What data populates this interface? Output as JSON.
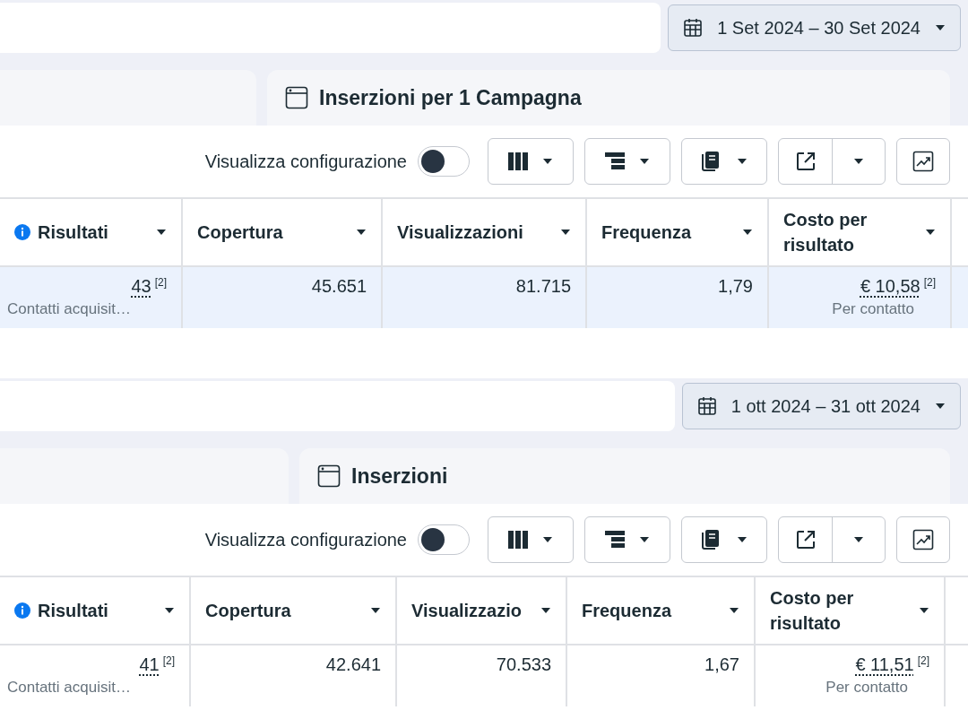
{
  "panels": [
    {
      "date_range": "1 Set 2024 – 30 Set 2024",
      "tab_title": "Inserzioni per 1 Campagna",
      "toggle_label": "Visualizza configurazione",
      "toggle_on": false,
      "columns": [
        {
          "label": "Risultati",
          "info": true
        },
        {
          "label": "Copertura",
          "info": false
        },
        {
          "label": "Visualizzazioni",
          "info": false
        },
        {
          "label": "Frequenza",
          "info": false
        },
        {
          "label": "Costo per risultato",
          "info": false
        }
      ],
      "row": {
        "selected": true,
        "cells": [
          {
            "value": "43",
            "note": "[2]",
            "sub": "Contatti acquisit…"
          },
          {
            "value": "45.651"
          },
          {
            "value": "81.715"
          },
          {
            "value": "1,79"
          },
          {
            "value": "€ 10,58",
            "note": "[2]",
            "sub": "Per contatto"
          }
        ]
      }
    },
    {
      "date_range": "1 ott 2024 – 31 ott 2024",
      "tab_title": "Inserzioni",
      "toggle_label": "Visualizza configurazione",
      "toggle_on": false,
      "columns": [
        {
          "label": "Risultati",
          "info": true
        },
        {
          "label": "Copertura",
          "info": false
        },
        {
          "label": "Visualizzazio",
          "info": false
        },
        {
          "label": "Frequenza",
          "info": false
        },
        {
          "label": "Costo per risultato",
          "info": false
        }
      ],
      "row": {
        "selected": false,
        "cells": [
          {
            "value": "41",
            "note": "[2]",
            "sub": "Contatti acquisit…"
          },
          {
            "value": "42.641"
          },
          {
            "value": "70.533"
          },
          {
            "value": "1,67"
          },
          {
            "value": "€ 11,51",
            "note": "[2]",
            "sub": "Per contatto"
          }
        ]
      }
    }
  ]
}
